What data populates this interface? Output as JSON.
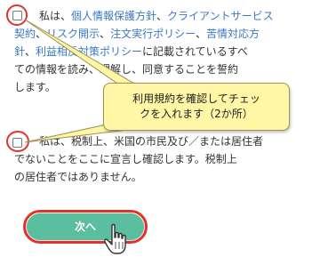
{
  "agreement1": {
    "prefix": "私は、",
    "link1": "個人情報保護方針",
    "sep1": "、",
    "link2": "クライアントサービス",
    "link2b": "契約",
    "sep2": "、",
    "link3": "リスク開示",
    "sep3": "、",
    "link4": "注文実行ポリシー",
    "sep4": "、",
    "link5": "苦情対応方",
    "link5b": "針",
    "sep5": "、",
    "link6": "利益相反対策ポリシー",
    "suffix1": "に記載されているすべ",
    "line4": "ての情報を読み、理解し、同意することを誓約",
    "line5": "します。"
  },
  "agreement2": {
    "line1": "私は、税制上、米国の市民及び／または居住者",
    "line2": "でないことをここに宣言し確認します。税制上",
    "line3": "の居住者ではありません。"
  },
  "callout": {
    "line1": "利用規約を確認してチェッ",
    "line2": "クを入れます（2か所）"
  },
  "next_button": {
    "label": "次へ"
  },
  "colors": {
    "link": "#3a78c3",
    "highlight_ring": "#e0332a",
    "button": "#5bbf9f",
    "callout_bg": "#fff6a6"
  }
}
